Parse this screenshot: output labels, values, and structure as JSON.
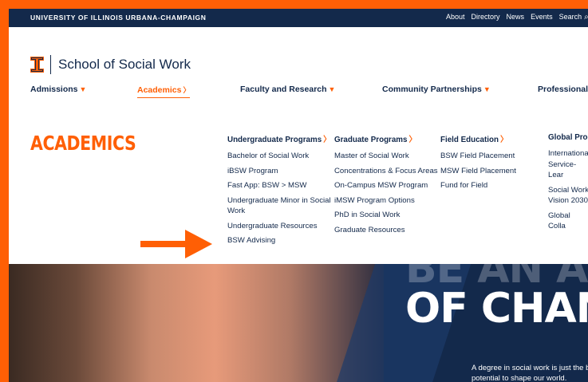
{
  "topbar": {
    "university": "UNIVERSITY OF ILLINOIS URBANA-CHAMPAIGN",
    "links": [
      "About",
      "Directory",
      "News",
      "Events",
      "Search"
    ]
  },
  "logo": {
    "school": "School of Social Work"
  },
  "nav": {
    "admissions": "Admissions",
    "academics": "Academics",
    "faculty": "Faculty and Research",
    "community": "Community Partnerships",
    "professional": "Professional E"
  },
  "mega": {
    "title": "ACADEMICS",
    "undergrad": {
      "heading": "Undergraduate Programs",
      "items": [
        "Bachelor of Social Work",
        "iBSW Program",
        "Fast App: BSW > MSW",
        "Undergraduate Minor in Social Work",
        "Undergraduate Resources",
        "BSW Advising"
      ]
    },
    "graduate": {
      "heading": "Graduate Programs",
      "items": [
        "Master of Social Work",
        "Concentrations & Focus Areas",
        "On-Campus MSW Program",
        "iMSW Program Options",
        "PhD in Social Work",
        "Graduate Resources"
      ]
    },
    "field": {
      "heading": "Field Education",
      "items": [
        "BSW Field Placement",
        "MSW Field Placement",
        "Fund for Field"
      ]
    },
    "global": {
      "heading": "Global Prog",
      "items": [
        "Internationa Service-Lear",
        "Social Work Vision 2030",
        "Global Colla"
      ]
    }
  },
  "hero": {
    "line1": "BE AN AGENT",
    "line2": "OF CHANG",
    "subtitle1": "A degree in social work is just the b",
    "subtitle2": "potential to shape our world."
  },
  "colors": {
    "navy": "#13294b",
    "orange": "#ff5f05"
  }
}
